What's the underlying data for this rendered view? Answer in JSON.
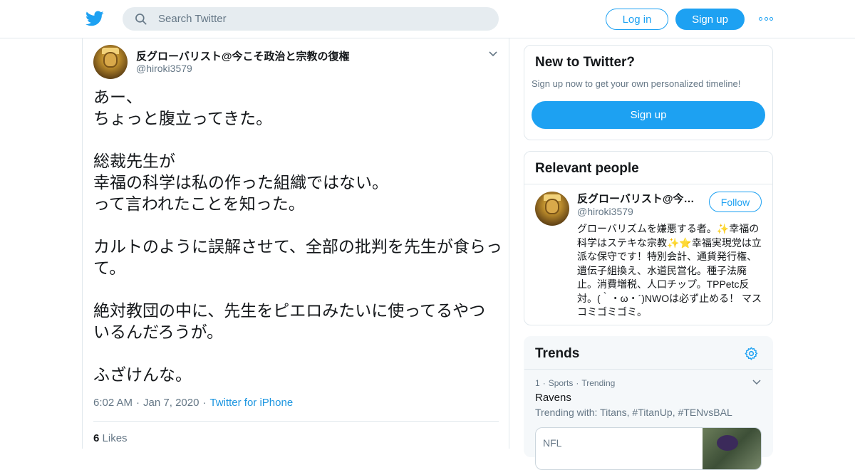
{
  "header": {
    "search_placeholder": "Search Twitter",
    "login_label": "Log in",
    "signup_label": "Sign up"
  },
  "tweet": {
    "author_name": "反グローバリスト@今こそ政治と宗教の復権",
    "author_handle": "@hiroki3579",
    "text": "あー、\nちょっと腹立ってきた。\n\n総裁先生が\n幸福の科学は私の作った組織ではない。\nって言われたことを知った。\n\nカルトのように誤解させて、全部の批判を先生が食らって。\n\n絶対教団の中に、先生をピエロみたいに使ってるやつ\nいるんだろうが。\n\nふざけんな。",
    "time": "6:02 AM",
    "date": "Jan 7, 2020",
    "source": "Twitter for iPhone",
    "likes_count": "6",
    "likes_label": "Likes"
  },
  "sidebar": {
    "new_to_twitter": {
      "title": "New to Twitter?",
      "subtitle": "Sign up now to get your own personalized timeline!",
      "signup_label": "Sign up"
    },
    "relevant_people": {
      "title": "Relevant people",
      "name": "反グローバリスト@今こそ政治と宗教の復権",
      "handle": "@hiroki3579",
      "follow_label": "Follow",
      "bio": "グローバリズムを嫌悪する者。✨幸福の科学はステキな宗教✨⭐幸福実現党は立派な保守です！特別会計、通貨発行権、遺伝子組換え、水道民営化。種子法廃止。消費増税、人口チップ。TPPetc反対。(｀・ω・´)NWOは必ず止める！ マスコミゴミゴミ。"
    },
    "trends": {
      "title": "Trends",
      "items": [
        {
          "rank": "1",
          "category": "Sports",
          "status": "Trending",
          "name": "Ravens",
          "trending_with": "Trending with: Titans, #TitanUp, #TENvsBAL",
          "card_label": "NFL"
        }
      ]
    }
  },
  "colors": {
    "accent": "#1da1f2",
    "text_primary": "#14171a",
    "text_secondary": "#657786",
    "border": "#e1e8ed"
  }
}
